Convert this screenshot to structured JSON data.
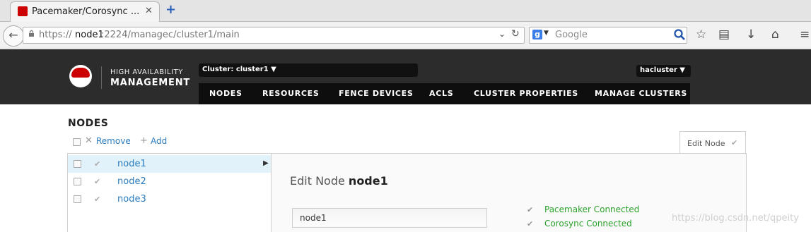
{
  "browser": {
    "tab_title": "Pacemaker/Corosync ...",
    "url_scheme": "https://",
    "url_host": "node1",
    "url_path": ":2224/managec/cluster1/main",
    "search_placeholder": "Google",
    "search_engine_letter": "g"
  },
  "header": {
    "logo_line1": "HIGH AVAILABILITY",
    "logo_line2": "MANAGEMENT",
    "cluster_label": "Cluster: cluster1 ▼",
    "user_label": "hacluster ▼",
    "nav": [
      "NODES",
      "RESOURCES",
      "FENCE DEVICES",
      "ACLS",
      "CLUSTER PROPERTIES",
      "MANAGE CLUSTERS"
    ]
  },
  "page": {
    "title": "NODES",
    "remove_label": "Remove",
    "add_label": "Add",
    "edit_tab_label": "Edit Node",
    "nodes": [
      "node1",
      "node2",
      "node3"
    ],
    "selected_node": "node1"
  },
  "detail": {
    "title_prefix": "Edit Node",
    "title_node": "node1",
    "input_value": "node1",
    "statuses": [
      "Pacemaker Connected",
      "Corosync Connected"
    ]
  },
  "watermark": "https://blog.csdn.net/qpeity",
  "colors": {
    "accent_link": "#2b7bbd",
    "status_ok": "#2ca12c",
    "header_bg": "#2c2c2c",
    "brand_red": "#cc0000"
  }
}
